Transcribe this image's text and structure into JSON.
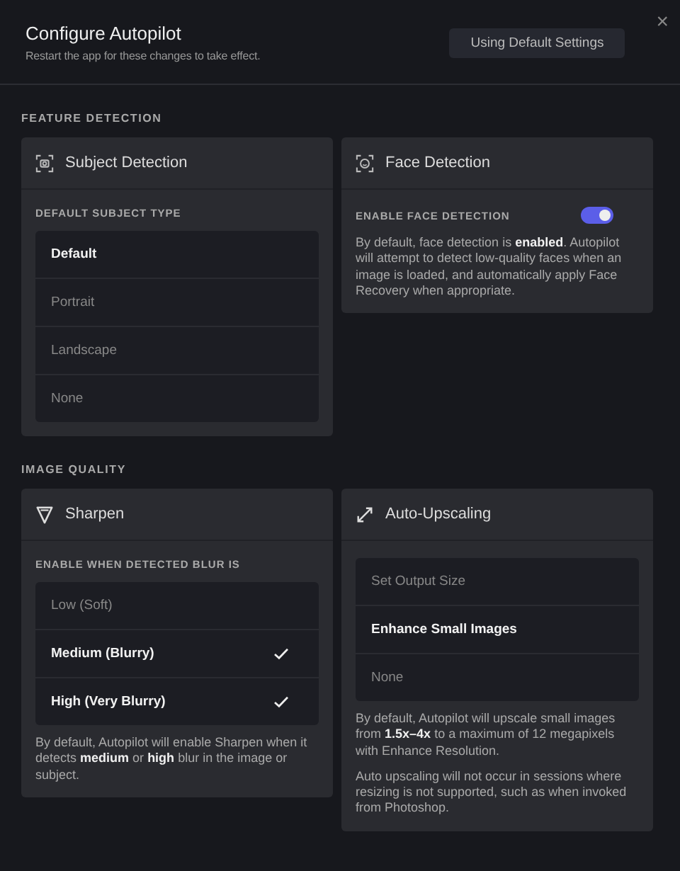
{
  "header": {
    "title": "Configure Autopilot",
    "subtitle": "Restart the app for these changes to take effect.",
    "button": "Using Default Settings",
    "close": "×"
  },
  "sections": [
    {
      "title": "FEATURE DETECTION",
      "cards": [
        {
          "title": "Subject Detection",
          "label": "DEFAULT SUBJECT TYPE",
          "items": [
            {
              "label": "Default",
              "selected": true
            },
            {
              "label": "Portrait",
              "selected": false
            },
            {
              "label": "Landscape",
              "selected": false
            },
            {
              "label": "None",
              "selected": false
            }
          ]
        },
        {
          "title": "Face Detection",
          "toggle": {
            "label": "ENABLE FACE DETECTION",
            "on": true
          },
          "notes": [
            "By default, face detection is **enabled**. Autopilot will attempt to detect low-quality faces when an image is loaded, and automatically apply Face Recovery when appropriate."
          ]
        }
      ]
    },
    {
      "title": "IMAGE QUALITY",
      "cards": [
        {
          "title": "Sharpen",
          "label": "ENABLE WHEN DETECTED BLUR IS",
          "items": [
            {
              "label": "Low (Soft)",
              "checked": false
            },
            {
              "label": "Medium (Blurry)",
              "checked": true
            },
            {
              "label": "High (Very Blurry)",
              "checked": true
            }
          ],
          "notes": [
            "By default, Autopilot will enable Sharpen when it detects **medium** or **high** blur in the image or subject."
          ]
        },
        {
          "title": "Auto-Upscaling",
          "items": [
            {
              "label": "Set Output Size",
              "selected": false
            },
            {
              "label": "Enhance Small Images",
              "selected": true
            },
            {
              "label": "None",
              "selected": false
            }
          ],
          "notes": [
            "By default, Autopilot will upscale small images from **1.5x–4x** to a maximum of 12 megapixels with Enhance Resolution.",
            "Auto upscaling will not occur in sessions where resizing is not supported, such as when invoked from Photoshop."
          ]
        }
      ]
    }
  ]
}
